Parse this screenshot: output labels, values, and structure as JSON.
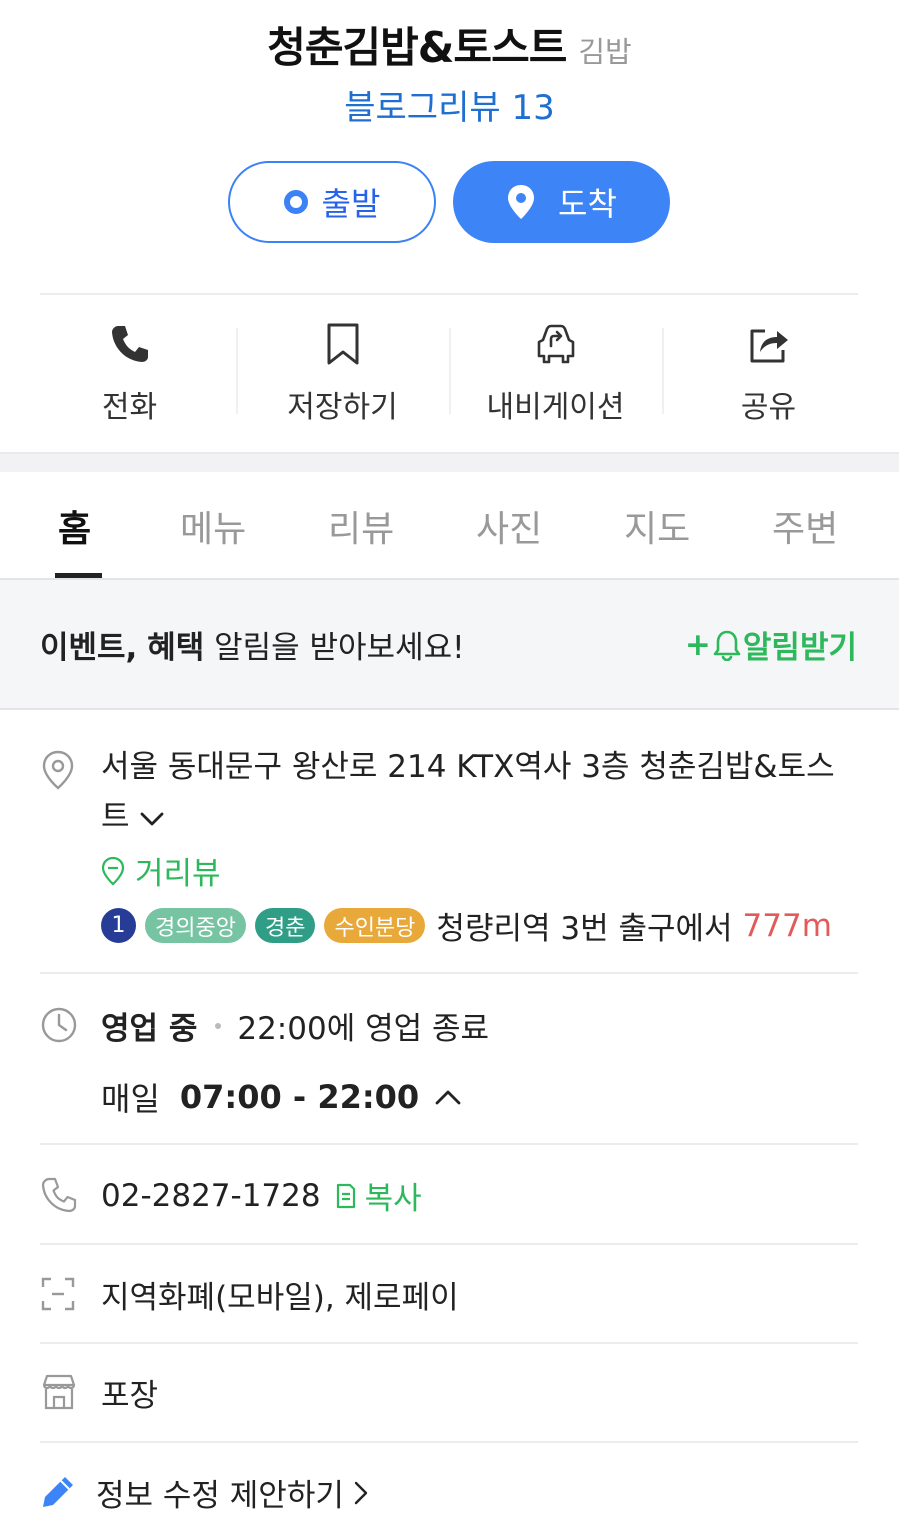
{
  "place": {
    "name": "청춘김밥&토스트",
    "category": "김밥",
    "blog_review": "블로그리뷰 13"
  },
  "route": {
    "depart_label": "출발",
    "arrive_label": "도착"
  },
  "actions": [
    {
      "label": "전화",
      "icon": "phone-icon"
    },
    {
      "label": "저장하기",
      "icon": "bookmark-icon"
    },
    {
      "label": "내비게이션",
      "icon": "car-navigation-icon"
    },
    {
      "label": "공유",
      "icon": "share-icon"
    }
  ],
  "tabs": [
    {
      "label": "홈",
      "active": true
    },
    {
      "label": "메뉴"
    },
    {
      "label": "리뷰"
    },
    {
      "label": "사진"
    },
    {
      "label": "지도"
    },
    {
      "label": "주변"
    }
  ],
  "notice": {
    "text_bold_1": "이벤트,",
    "text_bold_2": "혜택",
    "text_rest": " 알림을 받아보세요!",
    "button_plus": "+",
    "button_label": "알림받기"
  },
  "address": {
    "full": "서울 동대문구 왕산로 214 KTX역사 3층 청춘김밥&토스트",
    "roadview": "거리뷰"
  },
  "subway": {
    "line_num": "1",
    "lines": [
      {
        "label": "경의중앙",
        "color": "#77c4a3"
      },
      {
        "label": "경춘",
        "color": "#0c8e72"
      },
      {
        "label": "수인분당",
        "color": "#f5a200"
      }
    ],
    "station_text": "청량리역 3번 출구에서",
    "distance": "777m"
  },
  "hours": {
    "status": "영업 중",
    "close_info": "22:00에 영업 종료",
    "day": "매일",
    "time": "07:00 - 22:00"
  },
  "phone": {
    "number": "02-2827-1728",
    "copy_label": "복사"
  },
  "payment": "지역화폐(모바일), 제로페이",
  "takeout": "포장",
  "edit_suggest": "정보 수정 제안하기",
  "colors": {
    "primary": "#3d85f6",
    "green": "#2db85b",
    "distance_red": "#e25b5b"
  }
}
